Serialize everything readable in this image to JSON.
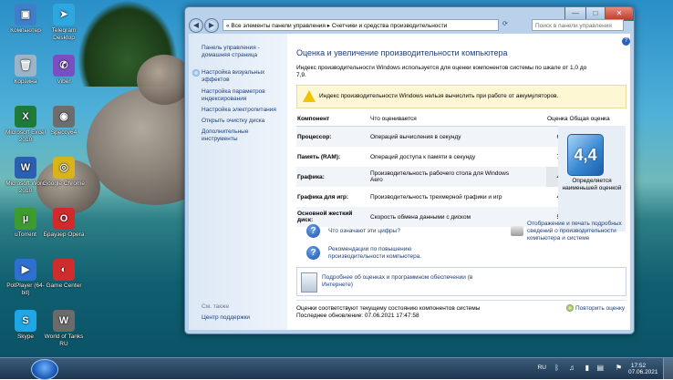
{
  "desktop": {
    "icons": [
      {
        "label": "Компьютер",
        "color": "#3f7fc9",
        "glyph": "▣"
      },
      {
        "label": "Telegram Desktop",
        "color": "#2ea6df",
        "glyph": "➤"
      },
      {
        "label": "Корзина",
        "color": "#9db4c8",
        "glyph": "🗑"
      },
      {
        "label": "Viber",
        "color": "#7a4fc2",
        "glyph": "✆"
      },
      {
        "label": "Microsoft Excel 2010",
        "color": "#1f7a3a",
        "glyph": "X"
      },
      {
        "label": "Speccy64",
        "color": "#6d6d6d",
        "glyph": "◉"
      },
      {
        "label": "Microsoft Word 2010",
        "color": "#2b5fb2",
        "glyph": "W"
      },
      {
        "label": "Google Chrome",
        "color": "#d6b41a",
        "glyph": "◎"
      },
      {
        "label": "uTorrent",
        "color": "#3e9b2e",
        "glyph": "µ"
      },
      {
        "label": "Браузер Opera",
        "color": "#d22a2a",
        "glyph": "O"
      },
      {
        "label": "PotPlayer (64-bit)",
        "color": "#2f6fd0",
        "glyph": "▶"
      },
      {
        "label": "Game Center",
        "color": "#cf2d2d",
        "glyph": "◐"
      },
      {
        "label": "Skype",
        "color": "#1ea6e6",
        "glyph": "S"
      },
      {
        "label": "World of Tanks RU",
        "color": "#6b6b6b",
        "glyph": "W"
      }
    ]
  },
  "taskbar": {
    "lang": "RU",
    "time": "17:52",
    "date": "07.06.2021"
  },
  "window": {
    "controls": {
      "minimize": "—",
      "maximize": "□",
      "close": "✕"
    },
    "nav": {
      "back": "◀",
      "forward": "▶"
    },
    "address": "« Все элементы панели управления ▸ Счетчики и средства производительности",
    "search_placeholder": "Поиск в панели управления",
    "left_panel": {
      "links": [
        "Панель управления - домашняя страница",
        "Настройка визуальных эффектов",
        "Настройка параметров индексирования",
        "Настройка электропитания",
        "Открыть очистку диска",
        "Дополнительные инструменты"
      ],
      "see_also": "См. также",
      "support_link": "Центр поддержки"
    },
    "main": {
      "title": "Оценка и увеличение производительности компьютера",
      "intro": "Индекс производительности Windows используется для оценки компонентов системы по шкале от 1,0 до 7,9.",
      "warning": "Индекс производительности Windows нельзя вычислить при работе от аккумуляторов.",
      "table": {
        "headers": [
          "Компонент",
          "Что оценивается",
          "Оценка",
          "Общая оценка"
        ],
        "rows": [
          {
            "component": "Процессор:",
            "what": "Операций вычисления в секунду",
            "score": "6,1"
          },
          {
            "component": "Память (RAM):",
            "what": "Операций доступа к памяти в секунду",
            "score": "7,1"
          },
          {
            "component": "Графика:",
            "what": "Производительность рабочего стола для Windows Aero",
            "score": "4,4"
          },
          {
            "component": "Графика для игр:",
            "what": "Производительность трехмерной графики и игр",
            "score": "4,5"
          },
          {
            "component": "Основной жесткий диск:",
            "what": "Скорость обмена данными с диском",
            "score": "5,9"
          }
        ]
      },
      "base_score": "4,4",
      "base_caption": "Определяется наименьшей оценкой",
      "help_link_1": "Что означают эти цифры?",
      "help_link_2": "Рекомендации по повышению производительности компьютера.",
      "print_link": "Отображение и печать подробных сведений о производительности компьютера и системе",
      "details_link": "Подробнее об оценках и программном обеспечении (в Интернете)",
      "status_1": "Оценки соответствуют текущему состоянию компонентов системы",
      "status_2": "Последнее обновление: 07.06.2021 17:47:58",
      "rerun": "Повторить оценку",
      "help_badge": "?"
    }
  }
}
